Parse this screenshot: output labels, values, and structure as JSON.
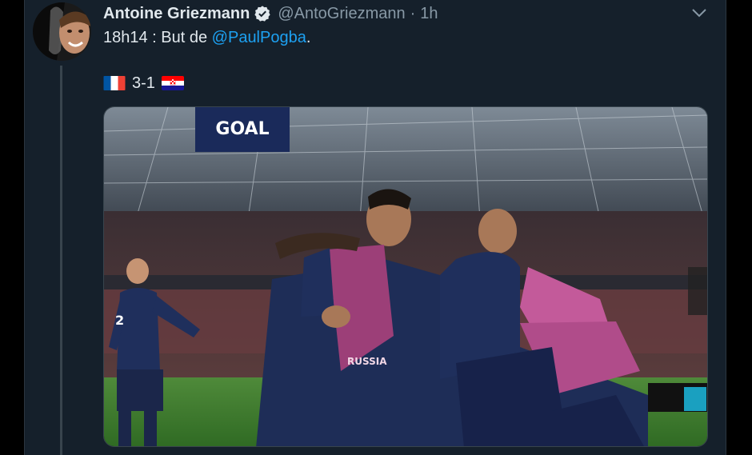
{
  "tweet": {
    "display_name": "Antoine Griezmann",
    "handle": "@AntoGriezmann",
    "separator": "·",
    "time": "1h",
    "text_prefix": "18h14 : But de ",
    "mention": "@PaulPogba",
    "text_suffix": ".",
    "score": "3-1"
  },
  "media": {
    "scoreboard_text": "GOAL",
    "jersey_number_left": "2",
    "shirt_text": "RUSSIA"
  },
  "icons": {
    "verified": "verified-badge-icon",
    "chevron": "chevron-down-icon",
    "flag_left": "france-flag-icon",
    "flag_right": "croatia-flag-icon"
  },
  "colors": {
    "background": "#15202b",
    "text": "#e1e8ed",
    "muted": "#8899a6",
    "accent": "#1da1f2"
  }
}
